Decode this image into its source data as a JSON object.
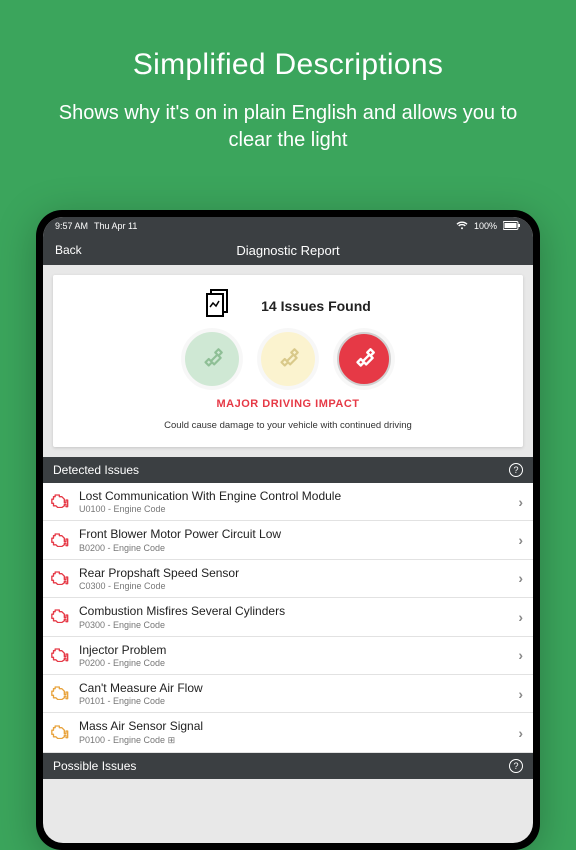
{
  "promo": {
    "title": "Simplified Descriptions",
    "subtitle": "Shows why it's on in plain English and allows you to clear the light"
  },
  "statusbar": {
    "time": "9:57 AM",
    "date": "Thu Apr 11",
    "battery": "100%"
  },
  "nav": {
    "back": "Back",
    "title": "Diagnostic Report"
  },
  "summary": {
    "issues_found": "14 Issues Found",
    "impact_label": "MAJOR DRIVING IMPACT",
    "impact_desc": "Could cause damage to your vehicle with continued driving"
  },
  "sections": {
    "detected": "Detected Issues",
    "possible": "Possible Issues"
  },
  "issues": [
    {
      "severity": "red",
      "title": "Lost Communication With Engine Control Module",
      "code": "U0100 - Engine Code"
    },
    {
      "severity": "red",
      "title": "Front Blower Motor Power Circuit Low",
      "code": "B0200 - Engine Code"
    },
    {
      "severity": "red",
      "title": "Rear Propshaft Speed Sensor",
      "code": "C0300 - Engine Code"
    },
    {
      "severity": "red",
      "title": "Combustion Misfires Several Cylinders",
      "code": "P0300 - Engine Code"
    },
    {
      "severity": "red",
      "title": "Injector Problem",
      "code": "P0200 - Engine Code"
    },
    {
      "severity": "yellow",
      "title": "Can't Measure Air Flow",
      "code": "P0101 - Engine Code"
    },
    {
      "severity": "yellow",
      "title": "Mass Air Sensor Signal",
      "code": "P0100 - Engine Code ⊞"
    }
  ],
  "colors": {
    "red": "#e63946",
    "yellow": "#e8a33d",
    "green_bg": "#cfe8d4"
  }
}
